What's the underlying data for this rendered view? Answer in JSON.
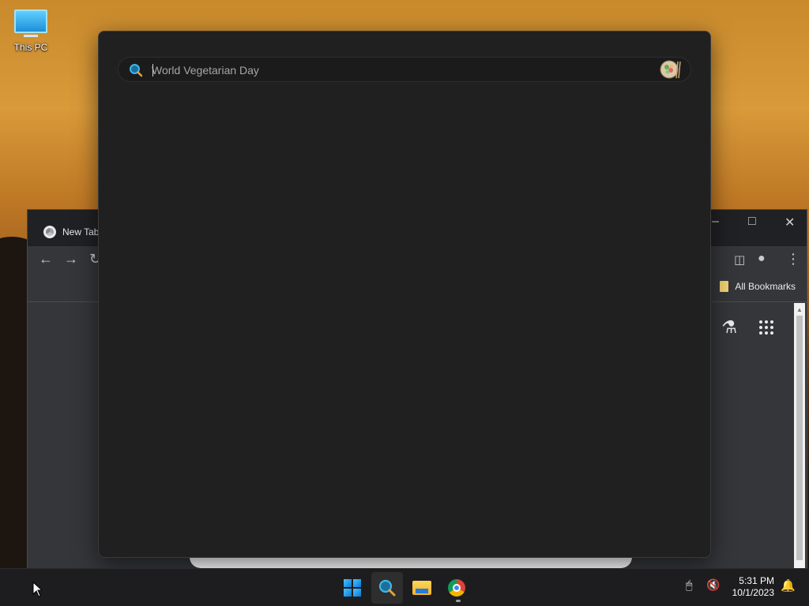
{
  "desktop": {
    "icons": [
      {
        "label": "This PC",
        "icon": "computer-icon"
      }
    ]
  },
  "browser": {
    "tab_title": "New Tab",
    "bookmarks_label": "All Bookmarks",
    "icons": [
      "back-arrow-icon",
      "forward-arrow-icon",
      "reload-icon",
      "side-panel-icon",
      "profile-icon",
      "more-menu-icon",
      "labs-flask-icon",
      "apps-grid-icon"
    ]
  },
  "search": {
    "placeholder": "World Vegetarian Day",
    "value": "",
    "doodle_icon": "vegetarian-bowl-icon"
  },
  "taskbar": {
    "apps": [
      "start-icon",
      "search-icon",
      "file-explorer-icon",
      "chrome-icon"
    ],
    "time": "5:31 PM",
    "date": "10/1/2023"
  },
  "colors": {
    "panel_bg": "#202020",
    "search_box_bg": "#1b1b1b",
    "taskbar_bg": "#1d1d1f",
    "accent": "#0a78d4"
  }
}
